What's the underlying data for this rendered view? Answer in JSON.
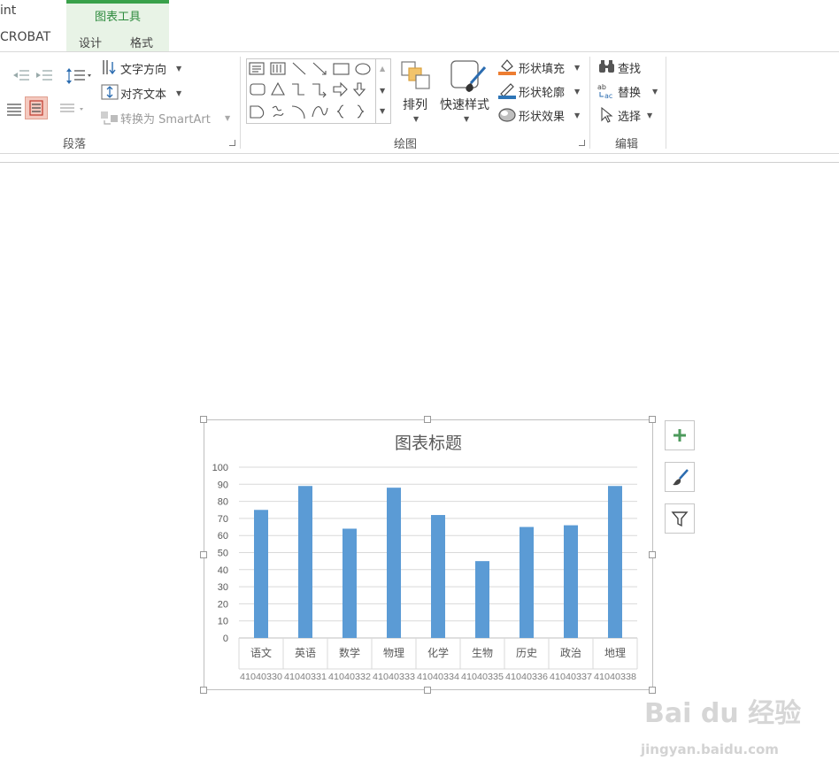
{
  "tabs": {
    "app_title_fragment": "int",
    "acrobat_tab": "CROBAT",
    "context_group_title": "图表工具",
    "design_tab": "设计",
    "format_tab": "格式"
  },
  "ribbon": {
    "paragraph": {
      "label": "段落",
      "text_direction": "文字方向",
      "align_text": "对齐文本",
      "convert_smartart": "转换为 SmartArt"
    },
    "drawing": {
      "label": "绘图",
      "arrange": "排列",
      "quick_styles": "快速样式",
      "shape_fill": "形状填充",
      "shape_outline": "形状轮廓",
      "shape_effects": "形状效果"
    },
    "editing": {
      "label": "编辑",
      "find": "查找",
      "replace": "替换",
      "select": "选择"
    }
  },
  "colors": {
    "bar": "#5b9bd5",
    "context_green": "#39a14a",
    "context_bg": "#e8f3e6",
    "grid": "#d9d9d9",
    "axis_text": "#595959"
  },
  "chart_data": {
    "type": "bar",
    "title": "图表标题",
    "categories": [
      "语文",
      "英语",
      "数学",
      "物理",
      "化学",
      "生物",
      "历史",
      "政治",
      "地理"
    ],
    "sub_categories": [
      "41040330",
      "41040331",
      "41040332",
      "41040333",
      "41040334",
      "41040335",
      "41040336",
      "41040337",
      "41040338"
    ],
    "values": [
      75,
      89,
      64,
      88,
      72,
      45,
      65,
      66,
      89
    ],
    "ylim": [
      0,
      100
    ],
    "yticks": [
      0,
      10,
      20,
      30,
      40,
      50,
      60,
      70,
      80,
      90,
      100
    ],
    "grid": true,
    "legend": "none"
  },
  "chart_tools": {
    "elements_icon": "plus-icon",
    "styles_icon": "brush-icon",
    "filters_icon": "filter-icon"
  },
  "watermark": {
    "brand": "Bai du 经验",
    "url": "jingyan.baidu.com"
  }
}
